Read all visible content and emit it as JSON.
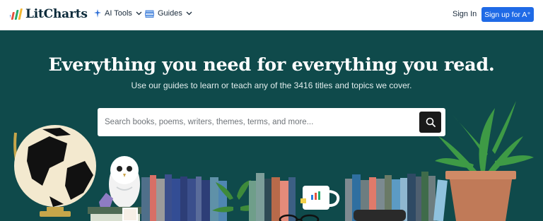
{
  "header": {
    "brand": "LitCharts",
    "nav": [
      {
        "label": "AI Tools",
        "icon": "sparkle-icon"
      },
      {
        "label": "Guides",
        "icon": "book-stack-icon"
      }
    ],
    "signin_label": "Sign In",
    "signup_label": "Sign up for A⁺"
  },
  "hero": {
    "title": "Everything you need for everything you read.",
    "subtitle": "Use our guides to learn or teach any of the 3416 titles and topics we cover.",
    "search": {
      "placeholder": "Search books, poems, writers, themes, terms, and more...",
      "value": ""
    }
  },
  "colors": {
    "hero_bg": "#0f4a4b",
    "accent": "#1f6ae6",
    "brand_text": "#0b2a3a"
  }
}
